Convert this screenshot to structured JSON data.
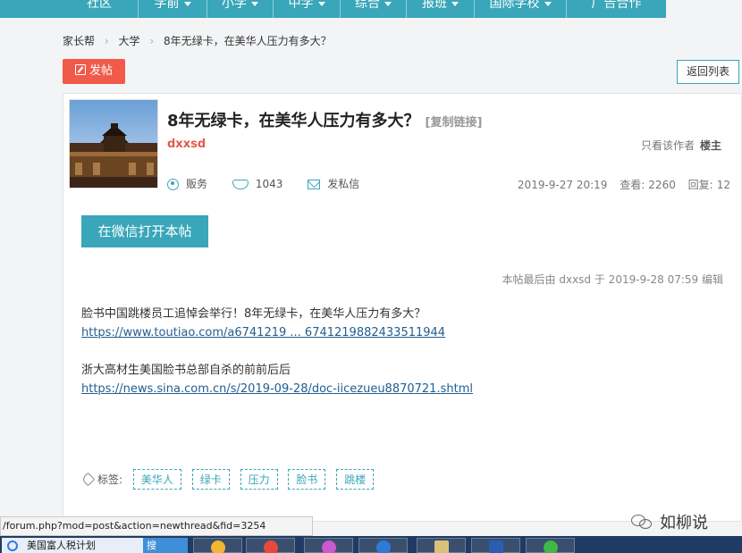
{
  "nav": {
    "items": [
      {
        "label": "社区",
        "caret": false
      },
      {
        "label": "学前",
        "caret": true
      },
      {
        "label": "小学",
        "caret": true
      },
      {
        "label": "中学",
        "caret": true
      },
      {
        "label": "综合",
        "caret": true
      },
      {
        "label": "报班",
        "caret": true
      },
      {
        "label": "国际学校",
        "caret": true
      },
      {
        "label": "广告合作",
        "caret": false
      }
    ]
  },
  "breadcrumb": {
    "home": "家长帮",
    "section": "大学",
    "current": "8年无绿卡，在美华人压力有多大？"
  },
  "buttons": {
    "post": "发帖",
    "back_to_list": "返回列表",
    "open_in_wechat": "在微信打开本帖"
  },
  "post": {
    "title": "8年无绿卡，在美华人压力有多大？",
    "copy_link": "[复制链接]",
    "author": "dxxsd",
    "only_author": "只看该作者",
    "louzhu": "楼主",
    "role": "贩务",
    "points": "1043",
    "send_message": "发私信",
    "date": "2019-9-27 20:19",
    "views_label": "查看:",
    "views": "2260",
    "replies_label": "回复:",
    "replies": "12",
    "edit_note": "本帖最后由 dxxsd 于 2019-9-28 07:59 编辑",
    "paragraphs": [
      {
        "text": "脸书中国跳楼员工追悼会举行！8年无绿卡，在美华人压力有多大？",
        "link": "https://www.toutiao.com/a6741219 ... 6741219882433511944"
      },
      {
        "text": "浙大高材生美国脸书总部自杀的前前后后",
        "link": "https://news.sina.com.cn/s/2019-09-28/doc-iicezueu8870721.shtml"
      }
    ],
    "tags_label": "标签:",
    "tags": [
      "美华人",
      "绿卡",
      "压力",
      "脸书",
      "跳楼"
    ]
  },
  "status_url": "/forum.php?mod=post&action=newthread&fid=3254",
  "watermark": "如柳说",
  "taskbar": {
    "browser_title": "美国富人税计划",
    "input_method": "搜 工"
  },
  "colors": {
    "accent": "#39a6b9",
    "post_button": "#f15a4a",
    "author": "#e35a4a",
    "link": "#225e90"
  }
}
